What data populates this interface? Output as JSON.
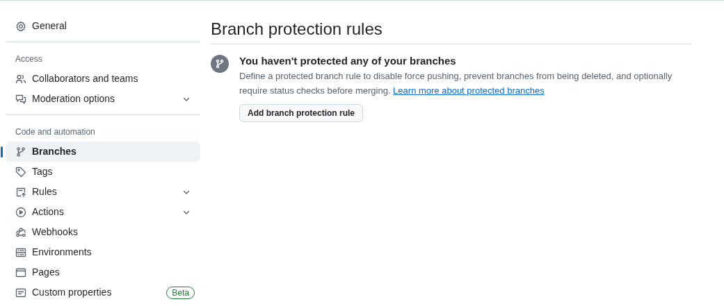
{
  "sidebar": {
    "sections": [
      {
        "items": [
          {
            "label": "General",
            "selected": false,
            "expandable": false
          }
        ]
      },
      {
        "heading": "Access",
        "items": [
          {
            "label": "Collaborators and teams",
            "selected": false,
            "expandable": false
          },
          {
            "label": "Moderation options",
            "selected": false,
            "expandable": true
          }
        ]
      },
      {
        "heading": "Code and automation",
        "items": [
          {
            "label": "Branches",
            "selected": true,
            "expandable": false
          },
          {
            "label": "Tags",
            "selected": false,
            "expandable": false
          },
          {
            "label": "Rules",
            "selected": false,
            "expandable": true
          },
          {
            "label": "Actions",
            "selected": false,
            "expandable": true
          },
          {
            "label": "Webhooks",
            "selected": false,
            "expandable": false
          },
          {
            "label": "Environments",
            "selected": false,
            "expandable": false
          },
          {
            "label": "Pages",
            "selected": false,
            "expandable": false
          },
          {
            "label": "Custom properties",
            "selected": false,
            "expandable": false,
            "badge": "Beta"
          }
        ]
      }
    ]
  },
  "main": {
    "title": "Branch protection rules",
    "blankslate": {
      "heading": "You haven't protected any of your branches",
      "description": "Define a protected branch rule to disable force pushing, prevent branches from being deleted, and optionally require status checks before merging.",
      "link": "Learn more about protected branches",
      "button": "Add branch protection rule"
    }
  }
}
